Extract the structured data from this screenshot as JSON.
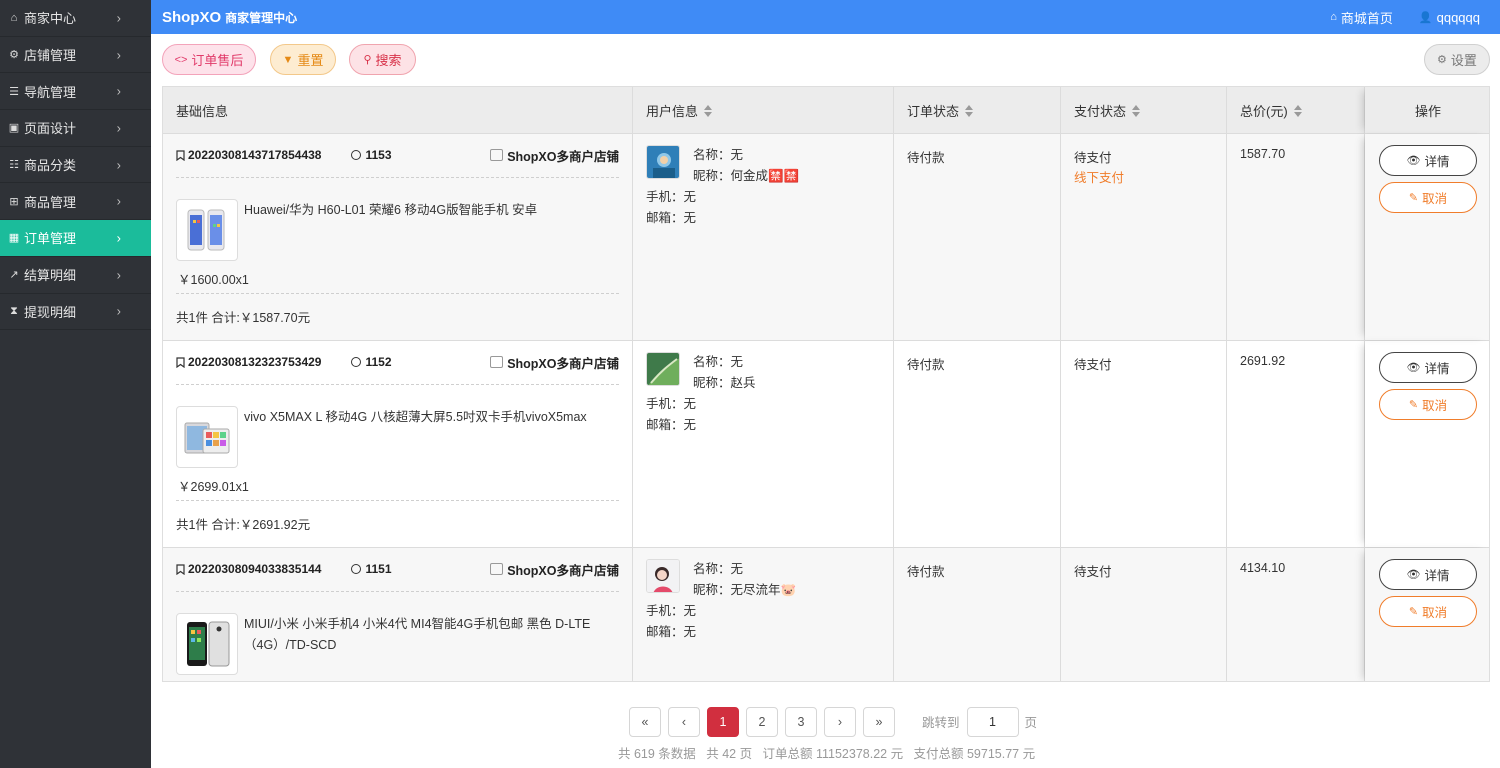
{
  "colors": {
    "sidebar_bg": "#2f3237",
    "sidebar_active": "#1bbc9b",
    "header_bg": "#3f8bf6",
    "accent_red": "#d12f3f",
    "accent_orange": "#f07d2b"
  },
  "sidebar": {
    "items": [
      {
        "label": "商家中心",
        "icon": "home-icon",
        "active": false
      },
      {
        "label": "店铺管理",
        "icon": "gear-icon",
        "active": false
      },
      {
        "label": "导航管理",
        "icon": "menu-icon",
        "active": false
      },
      {
        "label": "页面设计",
        "icon": "layout-icon",
        "active": false
      },
      {
        "label": "商品分类",
        "icon": "list-icon",
        "active": false
      },
      {
        "label": "商品管理",
        "icon": "basket-icon",
        "active": false
      },
      {
        "label": "订单管理",
        "icon": "grid-icon",
        "active": true
      },
      {
        "label": "结算明细",
        "icon": "chart-icon",
        "active": false
      },
      {
        "label": "提现明细",
        "icon": "hourglass-icon",
        "active": false
      }
    ]
  },
  "header": {
    "brand": "ShopXO",
    "subtitle": "商家管理中心",
    "home_link": "商城首页",
    "user": "qqqqqq"
  },
  "toolbar": {
    "after_sales": "订单售后",
    "reset": "重置",
    "search": "搜索",
    "settings": "设置"
  },
  "table": {
    "columns": [
      "基础信息",
      "用户信息",
      "订单状态",
      "支付状态",
      "总价(元)",
      "操作"
    ],
    "labels": {
      "name": "名称：",
      "nickname": "昵称：",
      "phone": "手机：",
      "email": "邮箱：",
      "detail": "详情",
      "cancel": "取消"
    },
    "rows": [
      {
        "order_no": "20220308143717854438",
        "count_no": "1153",
        "shop": "ShopXO多商户店铺",
        "goods_title": "Huawei/华为 H60-L01 荣耀6 移动4G版智能手机 安卓",
        "goods_price": "￥1600.00x1",
        "goods_total": "共1件 合计:￥1587.70元",
        "user_name": "无",
        "user_nickname": "何金成🈲🈲",
        "user_phone": "无",
        "user_email": "无",
        "order_status": "待付款",
        "pay_status": "待支付",
        "pay_method": "线下支付",
        "total": "1587.70"
      },
      {
        "order_no": "20220308132323753429",
        "count_no": "1152",
        "shop": "ShopXO多商户店铺",
        "goods_title": "vivo X5MAX L 移动4G 八核超薄大屏5.5吋双卡手机vivoX5max",
        "goods_price": "￥2699.01x1",
        "goods_total": "共1件 合计:￥2691.92元",
        "user_name": "无",
        "user_nickname": "赵兵",
        "user_phone": "无",
        "user_email": "无",
        "order_status": "待付款",
        "pay_status": "待支付",
        "pay_method": "",
        "total": "2691.92"
      },
      {
        "order_no": "20220308094033835144",
        "count_no": "1151",
        "shop": "ShopXO多商户店铺",
        "goods_title": "MIUI/小米 小米手机4 小米4代 MI4智能4G手机包邮 黑色 D-LTE（4G）/TD-SCD",
        "goods_price": "",
        "goods_total": "",
        "user_name": "无",
        "user_nickname": "无尽流年🐷",
        "user_phone": "无",
        "user_email": "无",
        "order_status": "待付款",
        "pay_status": "待支付",
        "pay_method": "",
        "total": "4134.10"
      }
    ]
  },
  "pagination": {
    "first": "«",
    "prev": "‹",
    "pages": [
      "1",
      "2",
      "3"
    ],
    "current": "1",
    "next": "›",
    "last": "»",
    "jump_label": "跳转到",
    "jump_value": "1",
    "jump_unit": "页",
    "summary": "共 619 条数据   共 42 页   订单总额 11152378.22 元   支付总额 59715.77 元"
  }
}
